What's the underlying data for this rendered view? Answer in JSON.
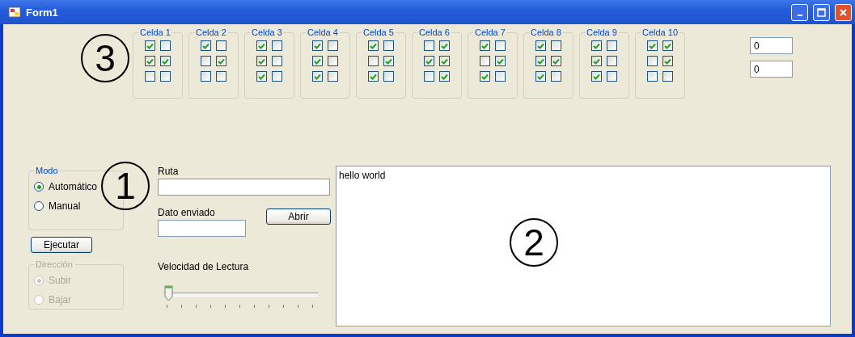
{
  "window": {
    "title": "Form1"
  },
  "cells": [
    {
      "label": "Celda 1",
      "rows": [
        [
          true,
          false
        ],
        [
          true,
          true
        ],
        [
          false,
          false
        ]
      ]
    },
    {
      "label": "Celda 2",
      "rows": [
        [
          true,
          false
        ],
        [
          false,
          true
        ],
        [
          false,
          false
        ]
      ]
    },
    {
      "label": "Celda 3",
      "rows": [
        [
          true,
          false
        ],
        [
          true,
          false
        ],
        [
          true,
          false
        ]
      ]
    },
    {
      "label": "Celda 4",
      "rows": [
        [
          true,
          false
        ],
        [
          true,
          false
        ],
        [
          true,
          false
        ]
      ]
    },
    {
      "label": "Celda 5",
      "rows": [
        [
          true,
          false
        ],
        [
          false,
          true
        ],
        [
          true,
          false
        ]
      ]
    },
    {
      "label": "Celda 6",
      "rows": [
        [
          false,
          true
        ],
        [
          true,
          true
        ],
        [
          false,
          true
        ]
      ]
    },
    {
      "label": "Celda 7",
      "rows": [
        [
          true,
          false
        ],
        [
          false,
          true
        ],
        [
          true,
          false
        ]
      ]
    },
    {
      "label": "Celda 8",
      "rows": [
        [
          true,
          false
        ],
        [
          true,
          true
        ],
        [
          true,
          false
        ]
      ]
    },
    {
      "label": "Celda 9",
      "rows": [
        [
          true,
          false
        ],
        [
          true,
          false
        ],
        [
          true,
          false
        ]
      ]
    },
    {
      "label": "Celda 10",
      "rows": [
        [
          true,
          true
        ],
        [
          false,
          true
        ],
        [
          false,
          false
        ]
      ]
    }
  ],
  "counters": [
    {
      "value": "0"
    },
    {
      "value": "0"
    }
  ],
  "modo": {
    "label": "Modo",
    "disabled": false,
    "options": [
      {
        "label": "Automático",
        "selected": true
      },
      {
        "label": "Manual",
        "selected": false
      }
    ]
  },
  "ejecutar": {
    "label": "Ejecutar"
  },
  "direccion": {
    "label": "Dirección",
    "disabled": true,
    "options": [
      {
        "label": "Subir",
        "selected": true
      },
      {
        "label": "Bajar",
        "selected": false
      }
    ]
  },
  "ruta": {
    "label": "Ruta"
  },
  "dato": {
    "label": "Dato enviado"
  },
  "abrir": {
    "label": "Abrir"
  },
  "velocidad": {
    "label": "Velocidad de Lectura",
    "level": 0
  },
  "output": {
    "value": "hello world"
  },
  "annotations": [
    {
      "label": "3"
    },
    {
      "label": "1"
    },
    {
      "label": "2"
    }
  ]
}
